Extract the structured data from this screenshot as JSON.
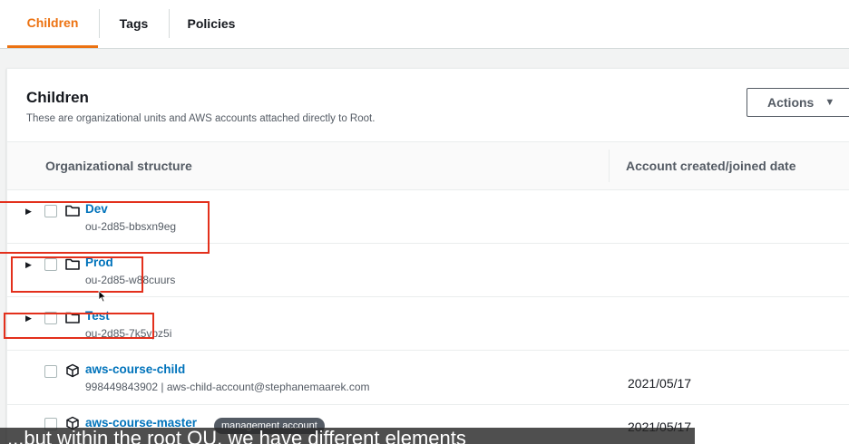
{
  "tabs": [
    {
      "label": "Children"
    },
    {
      "label": "Tags"
    },
    {
      "label": "Policies"
    }
  ],
  "colors": {
    "accent": "#ec7211",
    "link": "#0073bb",
    "highlight": "#e3301c"
  },
  "panel": {
    "title": "Children",
    "description": "These are organizational units and AWS accounts attached directly to Root.",
    "actions_label": "Actions"
  },
  "table": {
    "columns": [
      "Organizational structure",
      "Account created/joined date"
    ],
    "rows": [
      {
        "type": "ou",
        "name": "Dev",
        "id": "ou-2d85-bbsxn9eg",
        "date": ""
      },
      {
        "type": "ou",
        "name": "Prod",
        "id": "ou-2d85-w88cuurs",
        "date": ""
      },
      {
        "type": "ou",
        "name": "Test",
        "id": "ou-2d85-7k5vpz5i",
        "date": ""
      },
      {
        "type": "account",
        "name": "aws-course-child",
        "id": "998449843902 | aws-child-account@stephanemaarek.com",
        "date": "2021/05/17"
      },
      {
        "type": "account",
        "name": "aws-course-master",
        "badge": "management account",
        "id": "",
        "date": "2021/05/17"
      }
    ]
  },
  "icons": {
    "expand": "triangle-right-icon",
    "ou": "folder-icon",
    "account": "cube-icon"
  },
  "caption": "...but within the root OU, we have different elements"
}
